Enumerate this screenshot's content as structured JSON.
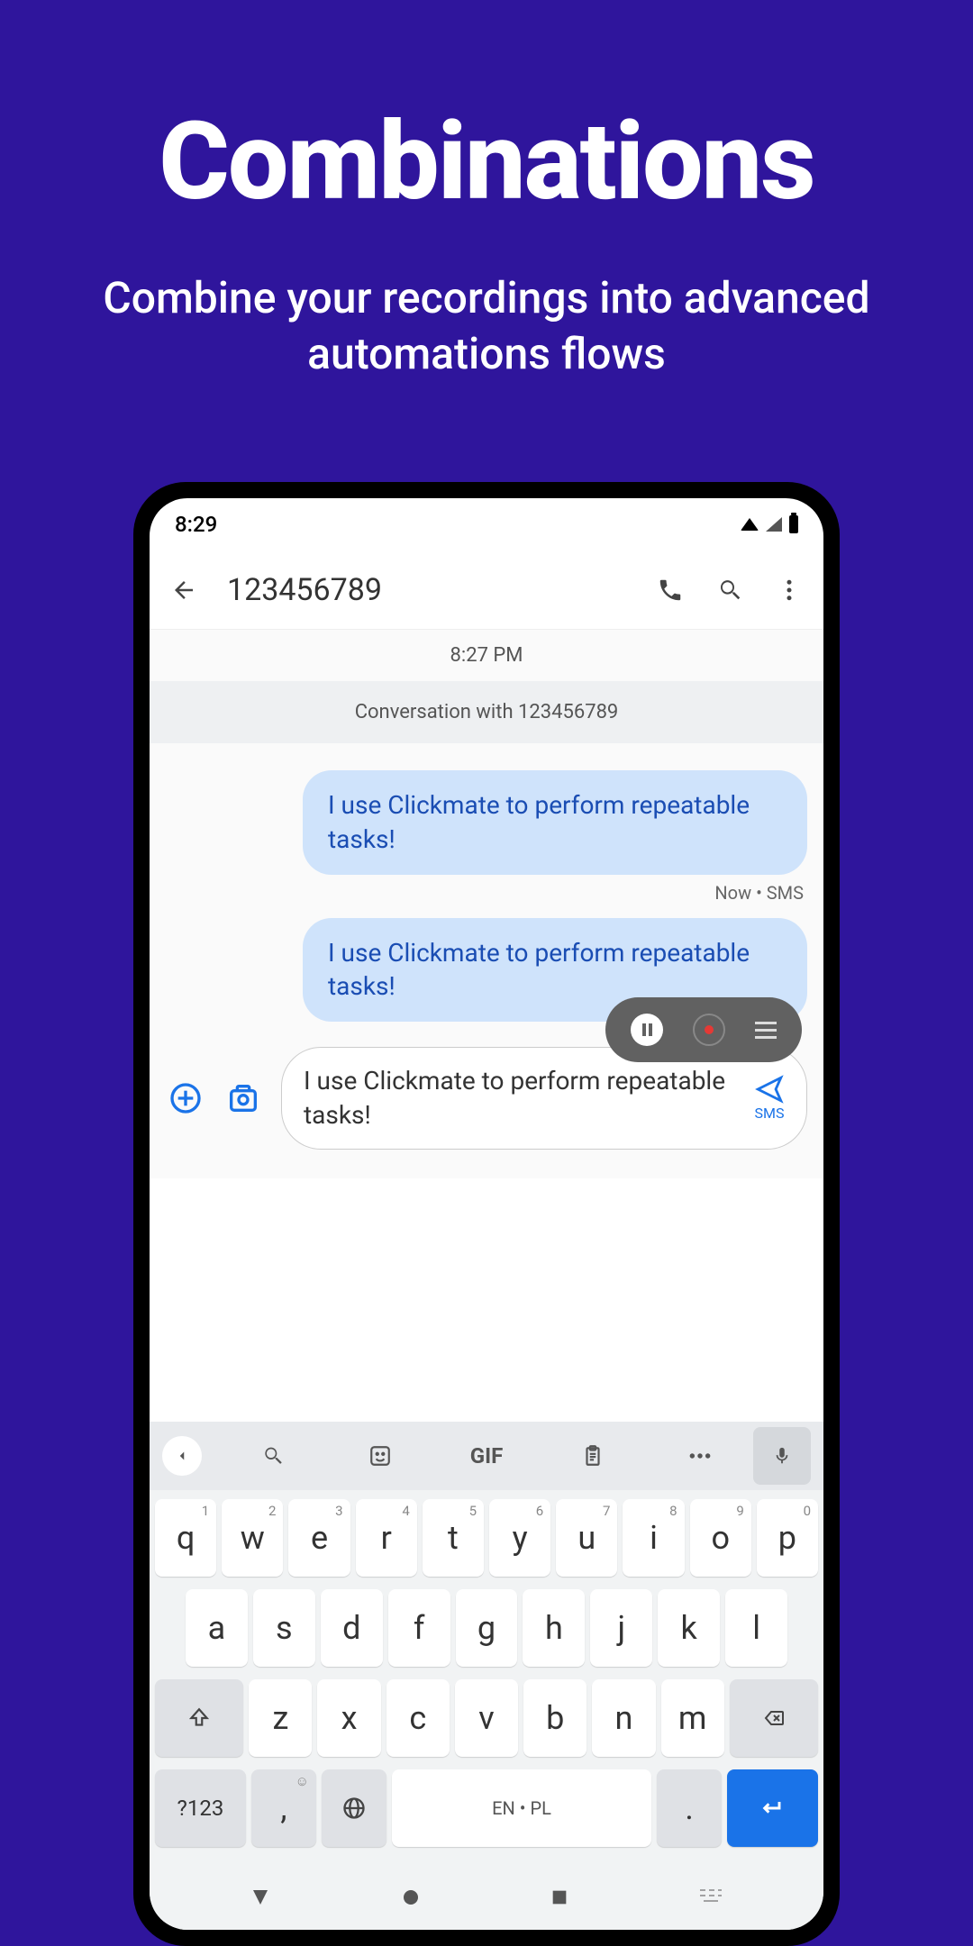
{
  "promo": {
    "title": "Combinations",
    "subtitle": "Combine your recordings into advanced automations flows"
  },
  "status": {
    "time": "8:29"
  },
  "appbar": {
    "title": "123456789"
  },
  "thread": {
    "time": "8:27 PM",
    "conv": "Conversation with 123456789",
    "msg1": "I use Clickmate to perform repeatable tasks!",
    "meta1": "Now • SMS",
    "msg2": "I use Clickmate to perform repeatable tasks!"
  },
  "compose": {
    "text": "I use Clickmate to perform repeatable tasks!",
    "send_label": "SMS"
  },
  "keyboard": {
    "gif": "GIF",
    "row1": [
      {
        "k": "q",
        "s": "1"
      },
      {
        "k": "w",
        "s": "2"
      },
      {
        "k": "e",
        "s": "3"
      },
      {
        "k": "r",
        "s": "4"
      },
      {
        "k": "t",
        "s": "5"
      },
      {
        "k": "y",
        "s": "6"
      },
      {
        "k": "u",
        "s": "7"
      },
      {
        "k": "i",
        "s": "8"
      },
      {
        "k": "o",
        "s": "9"
      },
      {
        "k": "p",
        "s": "0"
      }
    ],
    "row2": [
      "a",
      "s",
      "d",
      "f",
      "g",
      "h",
      "j",
      "k",
      "l"
    ],
    "row3": [
      "z",
      "x",
      "c",
      "v",
      "b",
      "n",
      "m"
    ],
    "sym": "?123",
    "comma": ",",
    "lang": "EN • PL",
    "period": "."
  }
}
